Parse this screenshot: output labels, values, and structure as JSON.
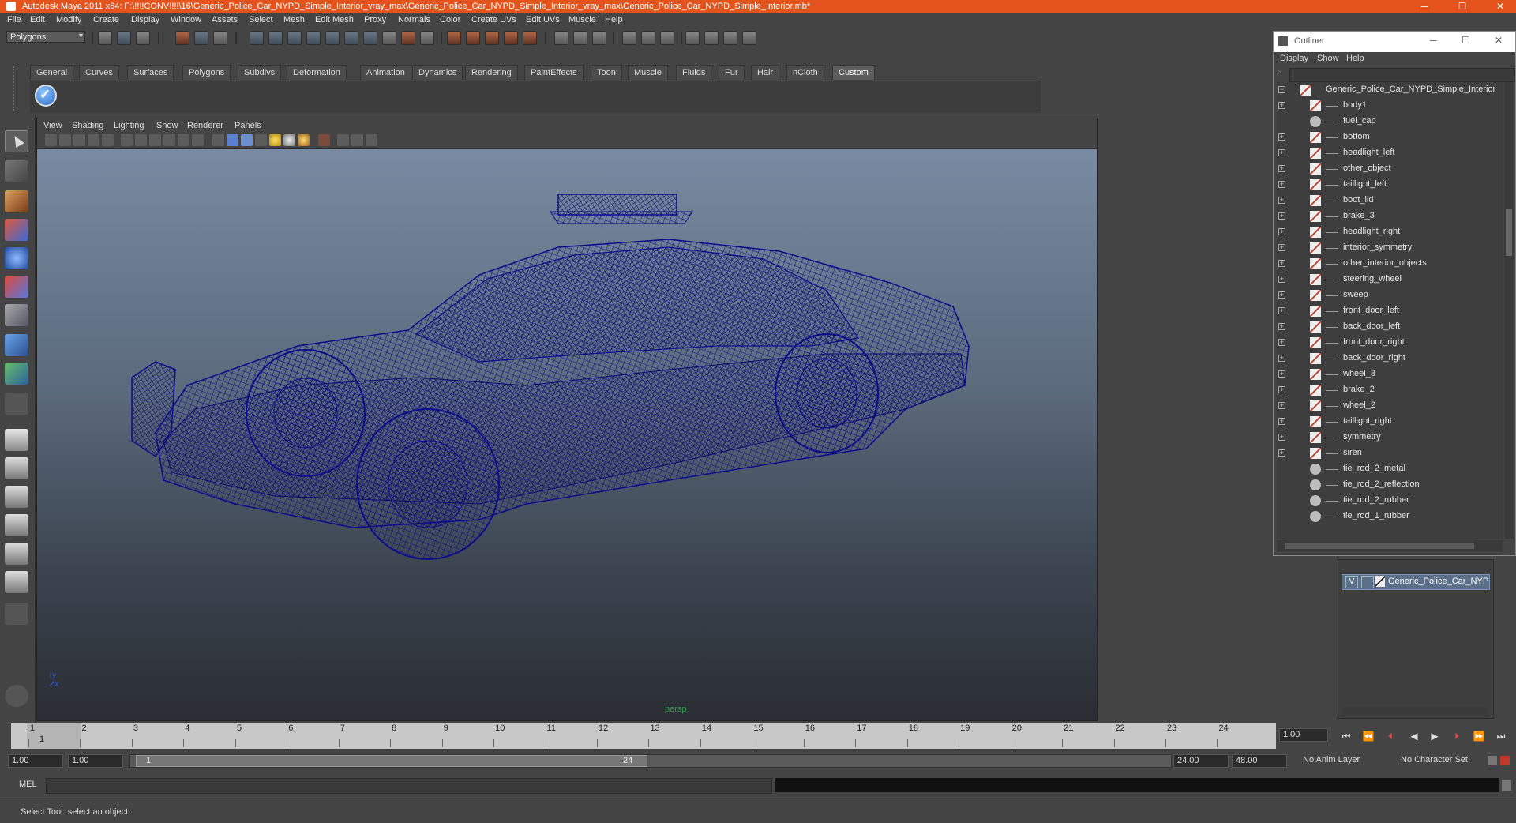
{
  "window": {
    "title": "Autodesk Maya 2011 x64: F:\\!!!!CONV!!!!\\16\\Generic_Police_Car_NYPD_Simple_Interior_vray_max\\Generic_Police_Car_NYPD_Simple_Interior_vray_max\\Generic_Police_Car_NYPD_Simple_Interior.mb*",
    "minimize": "─",
    "maximize": "☐",
    "close": "✕"
  },
  "menubar": [
    "File",
    "Edit",
    "Modify",
    "Create",
    "Display",
    "Window",
    "Assets",
    "Select",
    "Mesh",
    "Edit Mesh",
    "Proxy",
    "Normals",
    "Color",
    "Create UVs",
    "Edit UVs",
    "Muscle",
    "Help"
  ],
  "statusline": {
    "mode": "Polygons"
  },
  "shelf": {
    "tabs": [
      "General",
      "Curves",
      "Surfaces",
      "Polygons",
      "Subdivs",
      "Deformation",
      "Animation",
      "Dynamics",
      "Rendering",
      "PaintEffects",
      "Toon",
      "Muscle",
      "Fluids",
      "Fur",
      "Hair",
      "nCloth",
      "Custom"
    ],
    "active_tab": "Custom"
  },
  "viewport": {
    "menu": [
      "View",
      "Shading",
      "Lighting",
      "Show",
      "Renderer",
      "Panels"
    ],
    "camera_label": "persp",
    "wire_color": "#0c0c8a"
  },
  "outliner": {
    "title": "Outliner",
    "menu": [
      "Display",
      "Show",
      "Help"
    ],
    "root": "Generic_Police_Car_NYPD_Simple_Interior",
    "items": [
      {
        "label": "body1",
        "type": "mesh",
        "expand": "+"
      },
      {
        "label": "fuel_cap",
        "type": "grp",
        "expand": ""
      },
      {
        "label": "bottom",
        "type": "mesh",
        "expand": "+"
      },
      {
        "label": "headlight_left",
        "type": "mesh",
        "expand": "+"
      },
      {
        "label": "other_object",
        "type": "mesh",
        "expand": "+"
      },
      {
        "label": "taillight_left",
        "type": "mesh",
        "expand": "+"
      },
      {
        "label": "boot_lid",
        "type": "mesh",
        "expand": "+"
      },
      {
        "label": "brake_3",
        "type": "mesh",
        "expand": "+"
      },
      {
        "label": "headlight_right",
        "type": "mesh",
        "expand": "+"
      },
      {
        "label": "interior_symmetry",
        "type": "mesh",
        "expand": "+"
      },
      {
        "label": "other_interior_objects",
        "type": "mesh",
        "expand": "+"
      },
      {
        "label": "steering_wheel",
        "type": "mesh",
        "expand": "+"
      },
      {
        "label": "sweep",
        "type": "mesh",
        "expand": "+"
      },
      {
        "label": "front_door_left",
        "type": "mesh",
        "expand": "+"
      },
      {
        "label": "back_door_left",
        "type": "mesh",
        "expand": "+"
      },
      {
        "label": "front_door_right",
        "type": "mesh",
        "expand": "+"
      },
      {
        "label": "back_door_right",
        "type": "mesh",
        "expand": "+"
      },
      {
        "label": "wheel_3",
        "type": "mesh",
        "expand": "+"
      },
      {
        "label": "brake_2",
        "type": "mesh",
        "expand": "+"
      },
      {
        "label": "wheel_2",
        "type": "mesh",
        "expand": "+"
      },
      {
        "label": "taillight_right",
        "type": "mesh",
        "expand": "+"
      },
      {
        "label": "symmetry",
        "type": "mesh",
        "expand": "+"
      },
      {
        "label": "siren",
        "type": "mesh",
        "expand": "+"
      },
      {
        "label": "tie_rod_2_metal",
        "type": "grp",
        "expand": ""
      },
      {
        "label": "tie_rod_2_reflection",
        "type": "grp",
        "expand": ""
      },
      {
        "label": "tie_rod_2_rubber",
        "type": "grp",
        "expand": ""
      },
      {
        "label": "tie_rod_1_rubber",
        "type": "grp",
        "expand": ""
      }
    ]
  },
  "layers": {
    "visible_flag": "V",
    "layer_name": "Generic_Police_Car_NYPD"
  },
  "timeline": {
    "ticks": [
      "1",
      "2",
      "3",
      "4",
      "5",
      "6",
      "7",
      "8",
      "9",
      "10",
      "11",
      "12",
      "13",
      "14",
      "15",
      "16",
      "17",
      "18",
      "19",
      "20",
      "21",
      "22",
      "23",
      "24"
    ],
    "current_frame": "1",
    "current_time_field": "1.00"
  },
  "range": {
    "start_time": "1.00",
    "playback_start": "1.00",
    "handle_start": "1",
    "handle_end": "24",
    "playback_end": "24.00",
    "end_time": "48.00",
    "anim_layer": "No Anim Layer",
    "character_set": "No Character Set"
  },
  "command_line": {
    "label": "MEL"
  },
  "help_line": {
    "text": "Select Tool: select an object"
  }
}
